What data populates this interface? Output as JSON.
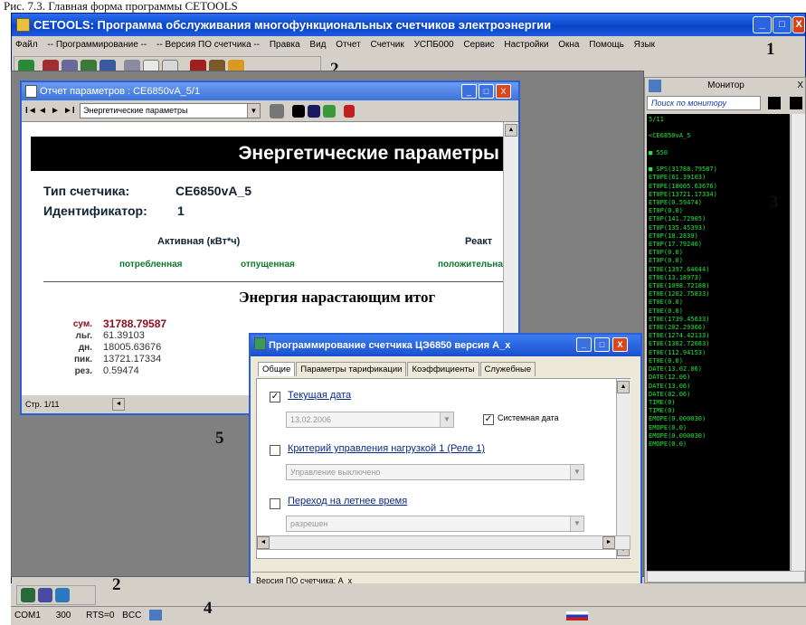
{
  "caption": "Рис. 7.3. Главная форма программы CETOOLS",
  "window": {
    "title": "CETOOLS: Программа обслуживания многофункциональных счетчиков электроэнергии",
    "minimize": "_",
    "maximize": "□",
    "close": "X"
  },
  "menu": [
    "Файл",
    "-- Программирование --",
    "-- Версия ПО счетчика --",
    "Правка",
    "Вид",
    "Отчет",
    "Счетчик",
    "УСПБ000",
    "Сервис",
    "Настройки",
    "Окна",
    "Помощь",
    "Язык"
  ],
  "numbers": {
    "n1": "1",
    "n2a": "2",
    "n2b": "2",
    "n3": "3",
    "n4": "4",
    "n5": "5"
  },
  "report": {
    "title": "Отчет параметров : CE6850vA_5/1",
    "nav": {
      "first": "I◄",
      "prev": "◄",
      "next": "►",
      "last": "►I"
    },
    "select_value": "Энергетические параметры",
    "heading": "Энергетические параметры",
    "meter_type_label": "Тип счетчика:",
    "meter_type_value": "CE6850vA_5",
    "id_label": "Идентификатор:",
    "id_value": "1",
    "active_label": "Активная  (кВт*ч)",
    "reactive_label": "Реакт",
    "consumed": "потребленная",
    "released": "отпущенная",
    "positive": "положительна",
    "section": "Энергия нарастающим итог",
    "rows": [
      {
        "label": "сум.",
        "value": "31788.79587"
      },
      {
        "label": "льг.",
        "value": "61.39103"
      },
      {
        "label": "дн.",
        "value": "18005.63676"
      },
      {
        "label": "пик.",
        "value": "13721.17334"
      },
      {
        "label": "рез.",
        "value": "0.59474"
      }
    ],
    "page": "Стр. 1/11"
  },
  "prog": {
    "title": "Программирование счетчика ЦЭ6850 версия A_x",
    "tabs": [
      "Общие",
      "Параметры тарификации",
      "Коэффициенты",
      "Служебные"
    ],
    "date_label": "Текущая дата",
    "date_value": "13.02.2006",
    "sysdate_label": "Системная дата",
    "load_label": "Критерий управления нагрузкой 1 (Реле 1)",
    "load_value": "Управление выключено",
    "summer_label": "Переход на летнее время",
    "summer_value": "разрешен",
    "status": "Версия ПО счетчика: A_x"
  },
  "monitor": {
    "title": "Монитор",
    "search": "Поиск по монитору",
    "lines": [
      "5/11",
      "",
      "<CE6850vA_5",
      "",
      "■ 550",
      "",
      "■ SPS(31788.79587)",
      "ET0PE(61.39103)",
      "ET0PE(18005.63676)",
      "ET0PE(13721.17334)",
      "ET0PE(0.59474)",
      "ET0P(0.0)",
      "ET0P(141.72905)",
      "ET0P(135.45393)",
      "ET0P(18.2839)",
      "ET0P(17.79240)",
      "ET0P(0.0)",
      "ET0P(0.0)",
      "ET0E(1397.64044)",
      "ET0E(13.18973)",
      "ET0E(1098.72188)",
      "ET0E(1202.75833)",
      "ET0E(0.0)",
      "ET0E(0.0)",
      "ET0E(1739.45633)",
      "ET0E(202.29366)",
      "ET0E(1274.42133)",
      "ET0E(1302.72083)",
      "ET0E(112.94153)",
      "ET0E(0.0)",
      "DATE(13.02.06)",
      "DATE(12.06)",
      "DATE(13.06)",
      "DATE(02.06)",
      "TIME(0)",
      "TIME(0)",
      "EMOPE(0.000030)",
      "EMOPE(0.0)",
      "EMOPE(0.000030)",
      "EMOPE(0.0)"
    ]
  },
  "status": {
    "port": "COM1",
    "baud": "300",
    "rts": "RTS=0",
    "bcc": "BCC"
  }
}
